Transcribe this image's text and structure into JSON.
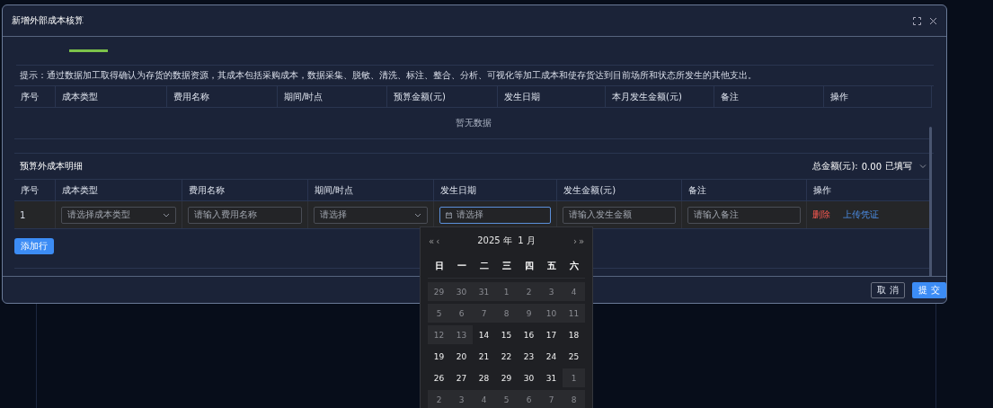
{
  "dialog": {
    "title": "新增外部成本核算"
  },
  "tip": "提示：通过数据加工取得确认为存货的数据资源，其成本包括采购成本，数据采集、脱敏、清洗、标注、整合、分析、可视化等加工成本和使存货达到目前场所和状态所发生的其他支出。",
  "budget_table": {
    "columns": [
      "序号",
      "成本类型",
      "费用名称",
      "期间/时点",
      "预算金额(元)",
      "发生日期",
      "本月发生金额(元)",
      "备注",
      "操作"
    ],
    "empty_text": "暂无数据"
  },
  "extra_section": {
    "title": "预算外成本明细",
    "total_label": "总金额(元):",
    "total_value": "0.00",
    "status": "已填写",
    "expanded": true,
    "columns": [
      "序号",
      "成本类型",
      "费用名称",
      "期间/时点",
      "发生日期",
      "发生金额(元)",
      "备注",
      "操作"
    ],
    "rows": [
      {
        "cells": [
          {
            "kind": "text",
            "text": "1"
          },
          {
            "kind": "select",
            "placeholder": "请选择成本类型"
          },
          {
            "kind": "input",
            "placeholder": "请输入费用名称"
          },
          {
            "kind": "select",
            "placeholder": "请选择"
          },
          {
            "kind": "date",
            "placeholder": "请选择",
            "focused": true
          },
          {
            "kind": "input",
            "placeholder": "请输入发生金额"
          },
          {
            "kind": "input",
            "placeholder": "请输入备注"
          },
          {
            "kind": "actions",
            "delete": "删除",
            "upload": "上传凭证"
          }
        ]
      }
    ],
    "add_button": "添加行"
  },
  "footer": {
    "cancel": "取 消",
    "submit": "提 交"
  },
  "calendar": {
    "prev_year": "«",
    "prev_month": "‹",
    "title": "2025 年  1 月",
    "next_month": "›",
    "next_year": "»",
    "weekdays": [
      "日",
      "一",
      "二",
      "三",
      "四",
      "五",
      "六"
    ],
    "weeks": [
      [
        {
          "day": "29",
          "disabled": true
        },
        {
          "day": "30",
          "disabled": true
        },
        {
          "day": "31",
          "disabled": true
        },
        {
          "day": "1",
          "disabled": true
        },
        {
          "day": "2",
          "disabled": true
        },
        {
          "day": "3",
          "disabled": true
        },
        {
          "day": "4",
          "disabled": true
        }
      ],
      [
        {
          "day": "5",
          "disabled": true
        },
        {
          "day": "6",
          "disabled": true
        },
        {
          "day": "7",
          "disabled": true
        },
        {
          "day": "8",
          "disabled": true
        },
        {
          "day": "9",
          "disabled": true
        },
        {
          "day": "10",
          "disabled": true
        },
        {
          "day": "11",
          "disabled": true
        }
      ],
      [
        {
          "day": "12",
          "disabled": true
        },
        {
          "day": "13",
          "disabled": true
        },
        {
          "day": "14",
          "disabled": false
        },
        {
          "day": "15",
          "disabled": false
        },
        {
          "day": "16",
          "disabled": false
        },
        {
          "day": "17",
          "disabled": false
        },
        {
          "day": "18",
          "disabled": false
        }
      ],
      [
        {
          "day": "19",
          "disabled": false
        },
        {
          "day": "20",
          "disabled": false
        },
        {
          "day": "21",
          "disabled": false
        },
        {
          "day": "22",
          "disabled": false
        },
        {
          "day": "23",
          "disabled": false
        },
        {
          "day": "24",
          "disabled": false
        },
        {
          "day": "25",
          "disabled": false
        }
      ],
      [
        {
          "day": "26",
          "disabled": false
        },
        {
          "day": "27",
          "disabled": false
        },
        {
          "day": "28",
          "disabled": false
        },
        {
          "day": "29",
          "disabled": false
        },
        {
          "day": "30",
          "disabled": false
        },
        {
          "day": "31",
          "disabled": false
        },
        {
          "day": "1",
          "disabled": true
        }
      ],
      [
        {
          "day": "2",
          "disabled": true
        },
        {
          "day": "3",
          "disabled": true
        },
        {
          "day": "4",
          "disabled": true
        },
        {
          "day": "5",
          "disabled": true
        },
        {
          "day": "6",
          "disabled": true
        },
        {
          "day": "7",
          "disabled": true
        },
        {
          "day": "8",
          "disabled": true
        }
      ]
    ]
  }
}
